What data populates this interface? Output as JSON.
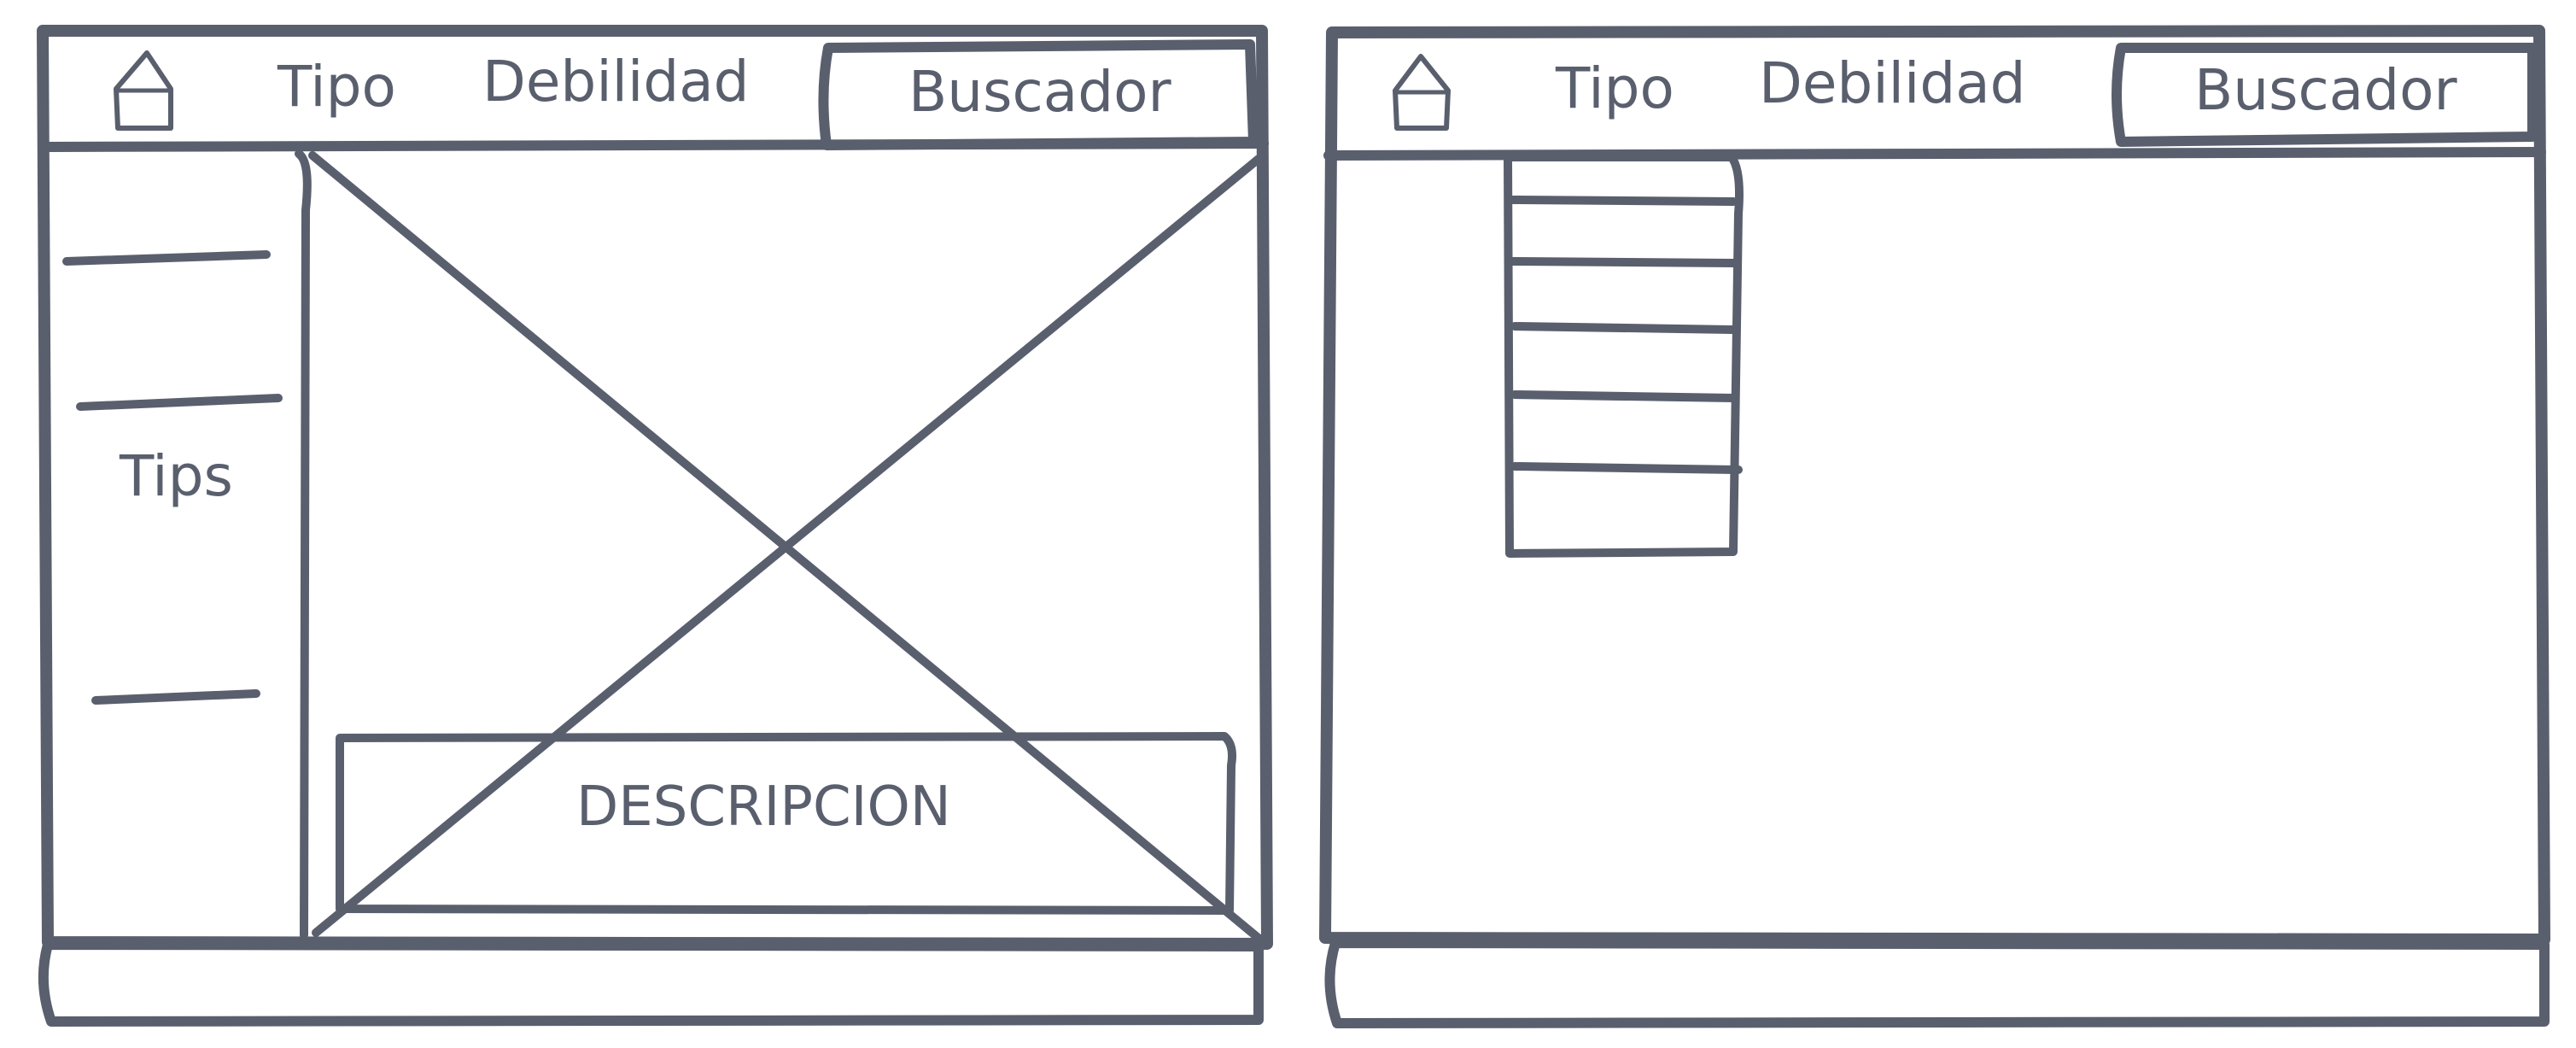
{
  "wireframes": [
    {
      "nav": {
        "tipo_label": "Tipo",
        "debilidad_label": "Debilidad",
        "buscador_label": "Buscador",
        "home_icon": "home-icon"
      },
      "sidebar": {
        "label": "Tips"
      },
      "main": {
        "description_label": "DESCRIPCION"
      }
    },
    {
      "nav": {
        "tipo_label": "Tipo",
        "debilidad_label": "Debilidad",
        "buscador_label": "Buscador",
        "home_icon": "home-icon"
      },
      "dropdown": {
        "item_count": 6
      }
    }
  ],
  "colors": {
    "stroke": "#5a5f6e",
    "background": "#ffffff"
  }
}
